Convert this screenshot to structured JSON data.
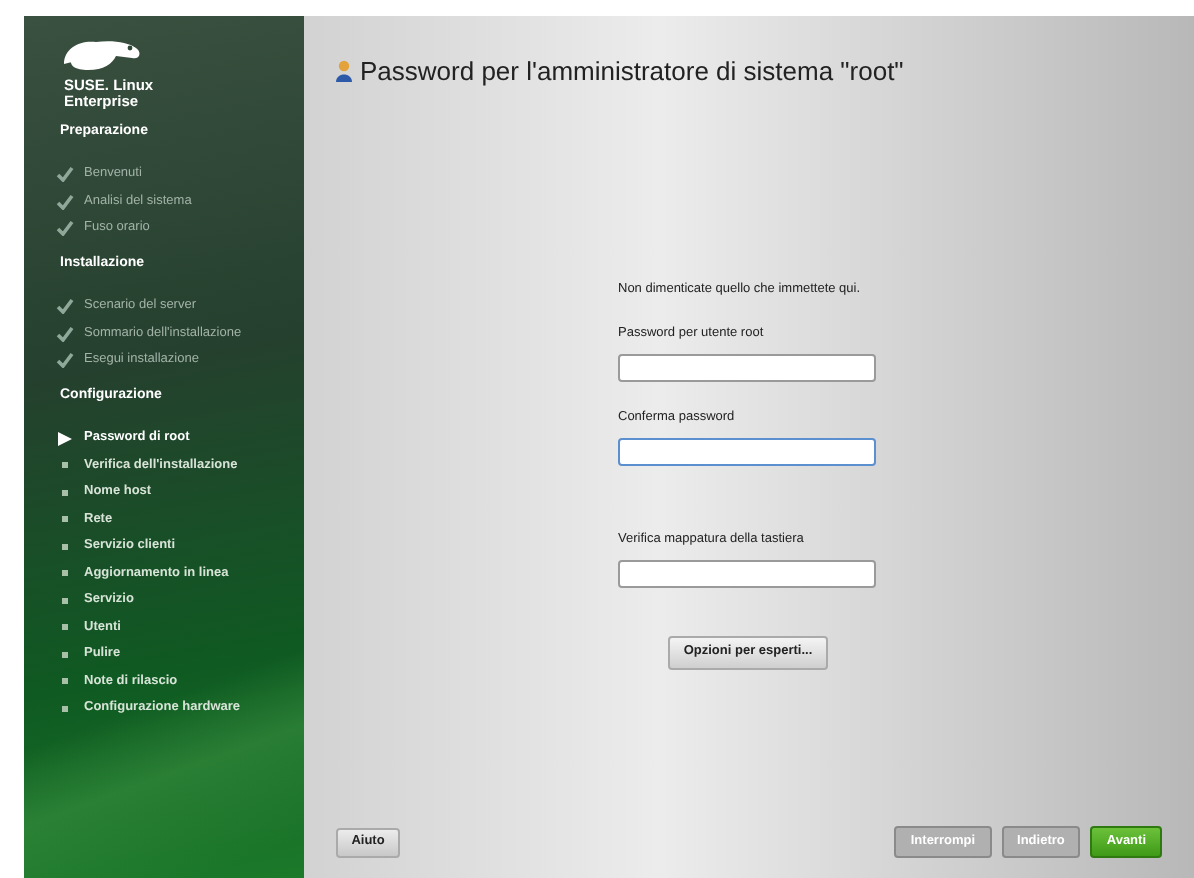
{
  "sidebar": {
    "logo_text": "SUSE. Linux Enterprise",
    "sections": [
      {
        "title": "Preparazione",
        "items": [
          {
            "label": "Benvenuti",
            "kind": "done"
          },
          {
            "label": "Analisi del sistema",
            "kind": "done"
          },
          {
            "label": "Fuso orario",
            "kind": "done"
          }
        ]
      },
      {
        "title": "Installazione",
        "items": [
          {
            "label": "Scenario del server",
            "kind": "done"
          },
          {
            "label": "Sommario dell'installazione",
            "kind": "done"
          },
          {
            "label": "Esegui installazione",
            "kind": "done"
          }
        ]
      },
      {
        "title": "Configurazione",
        "items": [
          {
            "label": "Password di root",
            "kind": "current"
          },
          {
            "label": "Verifica dell'installazione",
            "kind": "pending"
          },
          {
            "label": "Nome host",
            "kind": "pending"
          },
          {
            "label": "Rete",
            "kind": "pending"
          },
          {
            "label": "Servizio clienti",
            "kind": "pending"
          },
          {
            "label": "Aggiornamento in linea",
            "kind": "pending"
          },
          {
            "label": "Servizio",
            "kind": "pending"
          },
          {
            "label": "Utenti",
            "kind": "pending"
          },
          {
            "label": "Pulire",
            "kind": "pending"
          },
          {
            "label": "Note di rilascio",
            "kind": "pending"
          },
          {
            "label": "Configurazione hardware",
            "kind": "pending"
          }
        ]
      }
    ]
  },
  "title": "Password per l'amministratore di sistema \"root\"",
  "form": {
    "note": "Non dimenticate quello che immettete qui.",
    "fields": [
      {
        "label": "Password per utente root",
        "focused": false
      },
      {
        "label": "Conferma password",
        "focused": true
      },
      {
        "label": "Verifica mappatura della tastiera",
        "focused": false
      }
    ],
    "expert_button": "Opzioni per esperti..."
  },
  "footer": {
    "help": "Aiuto",
    "buttons": [
      {
        "label": "Interrompi",
        "kind": "ghost"
      },
      {
        "label": "Indietro",
        "kind": "ghost"
      },
      {
        "label": "Avanti",
        "kind": "primary"
      }
    ]
  }
}
